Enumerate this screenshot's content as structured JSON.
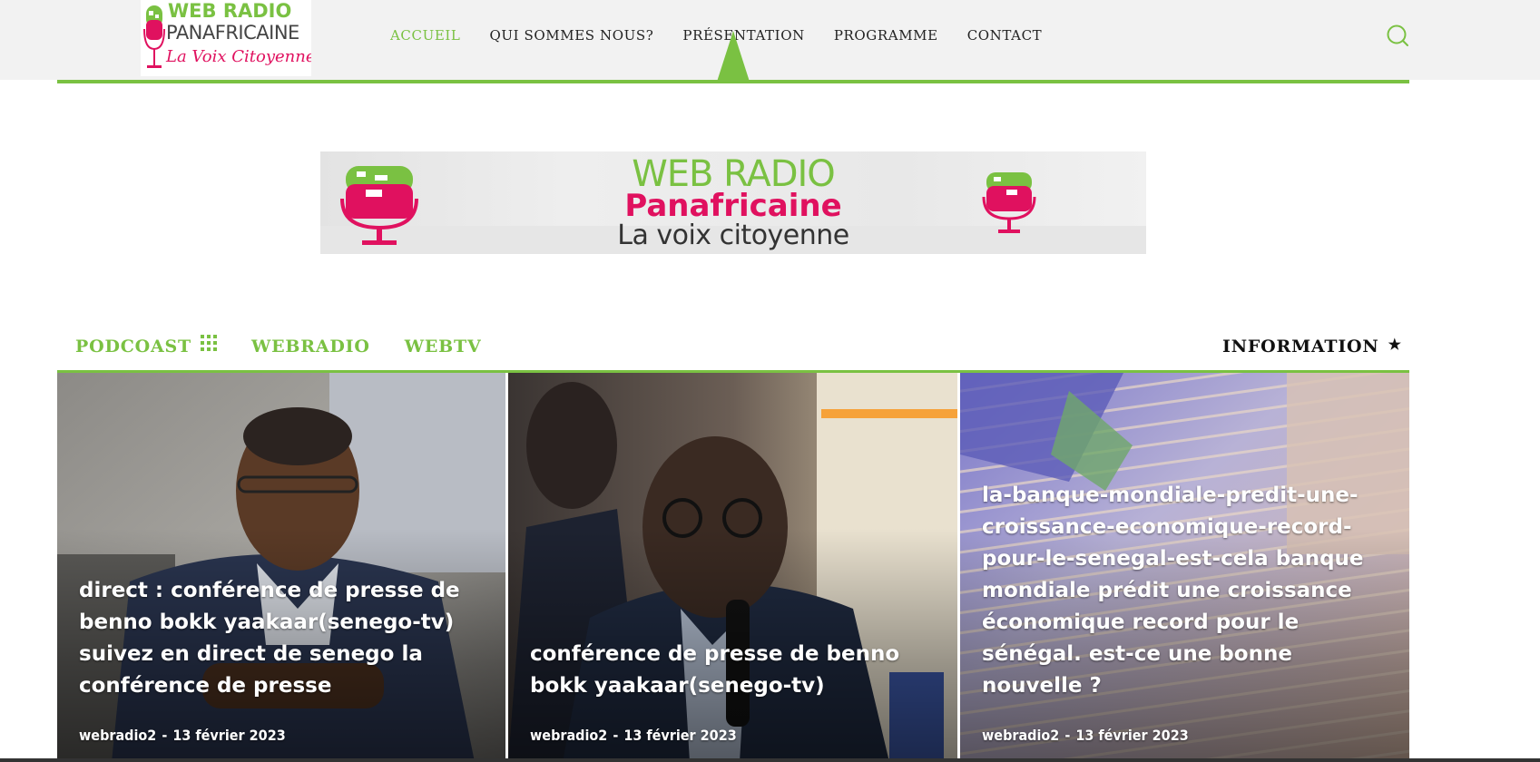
{
  "logo": {
    "line1": "WEB RADIO",
    "line2": "PANAFRICAINE",
    "line3": "La Voix Citoyenne"
  },
  "nav": {
    "items": [
      {
        "label": "ACCUEIL",
        "active": true
      },
      {
        "label": "QUI SOMMES NOUS?",
        "active": false
      },
      {
        "label": "PRÉSENTATION",
        "active": false
      },
      {
        "label": "PROGRAMME",
        "active": false
      },
      {
        "label": "CONTACT",
        "active": false
      }
    ]
  },
  "banner": {
    "line1": "WEB RADIO",
    "line2": "Panafricaine",
    "line3": "La voix citoyenne"
  },
  "tabs": {
    "items": [
      {
        "label": "PODCOAST"
      },
      {
        "label": "WEBRADIO"
      },
      {
        "label": "WEBTV"
      }
    ],
    "information": "INFORMATION"
  },
  "cards": [
    {
      "title": "direct : conférence de presse de benno bokk yaakaar(senego-tv) suivez en direct de senego la conférence de presse",
      "author": "webradio2",
      "date": "13 février 2023"
    },
    {
      "title": "conférence de presse de benno bokk yaakaar(senego-tv)",
      "author": "webradio2",
      "date": "13 février 2023"
    },
    {
      "title": "la-banque-mondiale-predit-une-croissance-economique-record-pour-le-senegal-est-cela banque mondiale prédit une croissance économique record pour le sénégal. est-ce une bonne nouvelle ?",
      "author": "webradio2",
      "date": "13 février 2023"
    }
  ],
  "colors": {
    "accent": "#7ac142",
    "brand_pink": "#e0115f",
    "header_bg": "#f2f2f2"
  },
  "icons": {
    "search": "search-icon",
    "grid": "grid-icon",
    "star": "star-icon",
    "microphone": "microphone-icon"
  }
}
